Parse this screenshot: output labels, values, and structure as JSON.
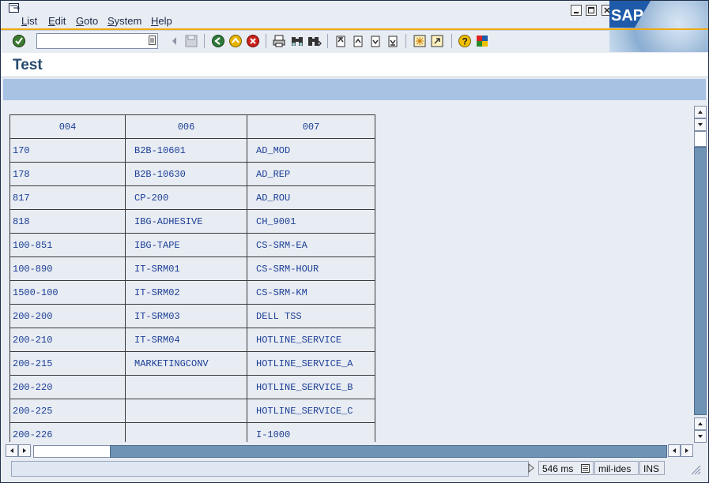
{
  "menu": [
    "List",
    "Edit",
    "Goto",
    "System",
    "Help"
  ],
  "brand": "SAP",
  "command_field": {
    "value": "",
    "placeholder": ""
  },
  "page_title": "Test",
  "table": {
    "headers": [
      "004",
      "006",
      "007"
    ],
    "rows": [
      [
        "170",
        "B2B-10601",
        "AD_MOD"
      ],
      [
        "178",
        "B2B-10630",
        "AD_REP"
      ],
      [
        "817",
        "CP-200",
        "AD_ROU"
      ],
      [
        "818",
        "IBG-ADHESIVE",
        "CH_9001"
      ],
      [
        "100-851",
        "IBG-TAPE",
        "CS-SRM-EA"
      ],
      [
        "100-890",
        "IT-SRM01",
        "CS-SRM-HOUR"
      ],
      [
        "1500-100",
        "IT-SRM02",
        "CS-SRM-KM"
      ],
      [
        "200-200",
        "IT-SRM03",
        "DELL TSS"
      ],
      [
        "200-210",
        "IT-SRM04",
        "HOTLINE_SERVICE"
      ],
      [
        "200-215",
        "MARKETINGCONV",
        "HOTLINE_SERVICE_A"
      ],
      [
        "200-220",
        "",
        "HOTLINE_SERVICE_B"
      ],
      [
        "200-225",
        "",
        "HOTLINE_SERVICE_C"
      ],
      [
        "200-226",
        "",
        "I-1000"
      ]
    ]
  },
  "status": {
    "message": "",
    "response_time": "546 ms",
    "system": "mil-ides",
    "mode": "INS"
  },
  "colors": {
    "accent_line": "#f0a800",
    "app_toolbar": "#a8c2e4",
    "title_text": "#254a6e",
    "list_text": "#1c3f96"
  }
}
